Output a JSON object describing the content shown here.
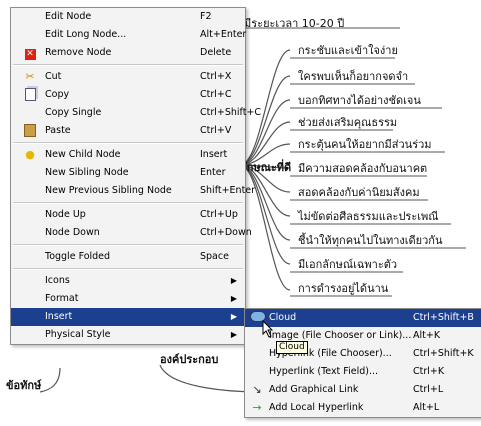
{
  "mindmap": {
    "top_node": "มีระยะเวลา 10-20 ปี",
    "branch_label": "ลักษณะที่ดี",
    "left_bottom_node": "ข้อทักษ์",
    "bottom_node": "องค์ประกอบ",
    "leaves": [
      "กระชับและเข้าใจง่าย",
      "ใครพบเห็นก็อยากจดจำ",
      "บอกทิศทางได้อย่างชัดเจน",
      "ช่วยส่งเสริมคุณธรรม",
      "กระตุ้นคนให้อยากมีส่วนร่วม",
      "มีความสอดคล้องกับอนาคต",
      "สอดคล้องกับค่านิยมสังคม",
      "ไม่ขัดต่อศีลธรรมและประเพณี",
      "ชี้นำให้ทุกคนไปในทางเดียวกัน",
      "มีเอกลักษณ์เฉพาะตัว",
      "การดำรงอยู่ได้นาน"
    ]
  },
  "context_menu": [
    {
      "label": "Edit Node",
      "shortcut": "F2",
      "icon": ""
    },
    {
      "label": "Edit Long Node...",
      "shortcut": "Alt+Enter",
      "icon": ""
    },
    {
      "label": "Remove Node",
      "shortcut": "Delete",
      "icon": "remove-icon"
    },
    {
      "sep": true
    },
    {
      "label": "Cut",
      "shortcut": "Ctrl+X",
      "icon": "cut-icon"
    },
    {
      "label": "Copy",
      "shortcut": "Ctrl+C",
      "icon": "copy-icon"
    },
    {
      "label": "Copy Single",
      "shortcut": "Ctrl+Shift+C",
      "icon": ""
    },
    {
      "label": "Paste",
      "shortcut": "Ctrl+V",
      "icon": "paste-icon"
    },
    {
      "sep": true
    },
    {
      "label": "New Child Node",
      "shortcut": "Insert",
      "icon": "lightbulb-icon"
    },
    {
      "label": "New Sibling Node",
      "shortcut": "Enter",
      "icon": ""
    },
    {
      "label": "New Previous Sibling Node",
      "shortcut": "Shift+Enter",
      "icon": ""
    },
    {
      "sep": true
    },
    {
      "label": "Node Up",
      "shortcut": "Ctrl+Up",
      "icon": ""
    },
    {
      "label": "Node Down",
      "shortcut": "Ctrl+Down",
      "icon": ""
    },
    {
      "sep": true
    },
    {
      "label": "Toggle Folded",
      "shortcut": "Space",
      "icon": ""
    },
    {
      "sep": true
    },
    {
      "label": "Icons",
      "shortcut": "",
      "submenu": true,
      "icon": ""
    },
    {
      "label": "Format",
      "shortcut": "",
      "submenu": true,
      "icon": ""
    },
    {
      "label": "Insert",
      "shortcut": "",
      "submenu": true,
      "highlighted": true,
      "icon": ""
    },
    {
      "label": "Physical Style",
      "shortcut": "",
      "submenu": true,
      "icon": ""
    }
  ],
  "insert_submenu": [
    {
      "label": "Cloud",
      "shortcut": "Ctrl+Shift+B",
      "highlighted": true,
      "icon": "cloud-icon"
    },
    {
      "label": "Image (File Chooser or Link)...",
      "shortcut": "Alt+K",
      "icon": ""
    },
    {
      "label": "Hyperlink (File Chooser)...",
      "shortcut": "Ctrl+Shift+K",
      "icon": ""
    },
    {
      "label": "Hyperlink (Text Field)...",
      "shortcut": "Ctrl+K",
      "icon": ""
    },
    {
      "label": "Add Graphical Link",
      "shortcut": "Ctrl+L",
      "icon": "graphical-link-icon"
    },
    {
      "label": "Add Local Hyperlink",
      "shortcut": "Alt+L",
      "icon": "local-link-arrow-icon"
    }
  ],
  "tooltip": "Cloud",
  "colors": {
    "highlight": "#1c3f8f",
    "menu_bg": "#f3f3f3",
    "tooltip_bg": "#ffffe1"
  }
}
